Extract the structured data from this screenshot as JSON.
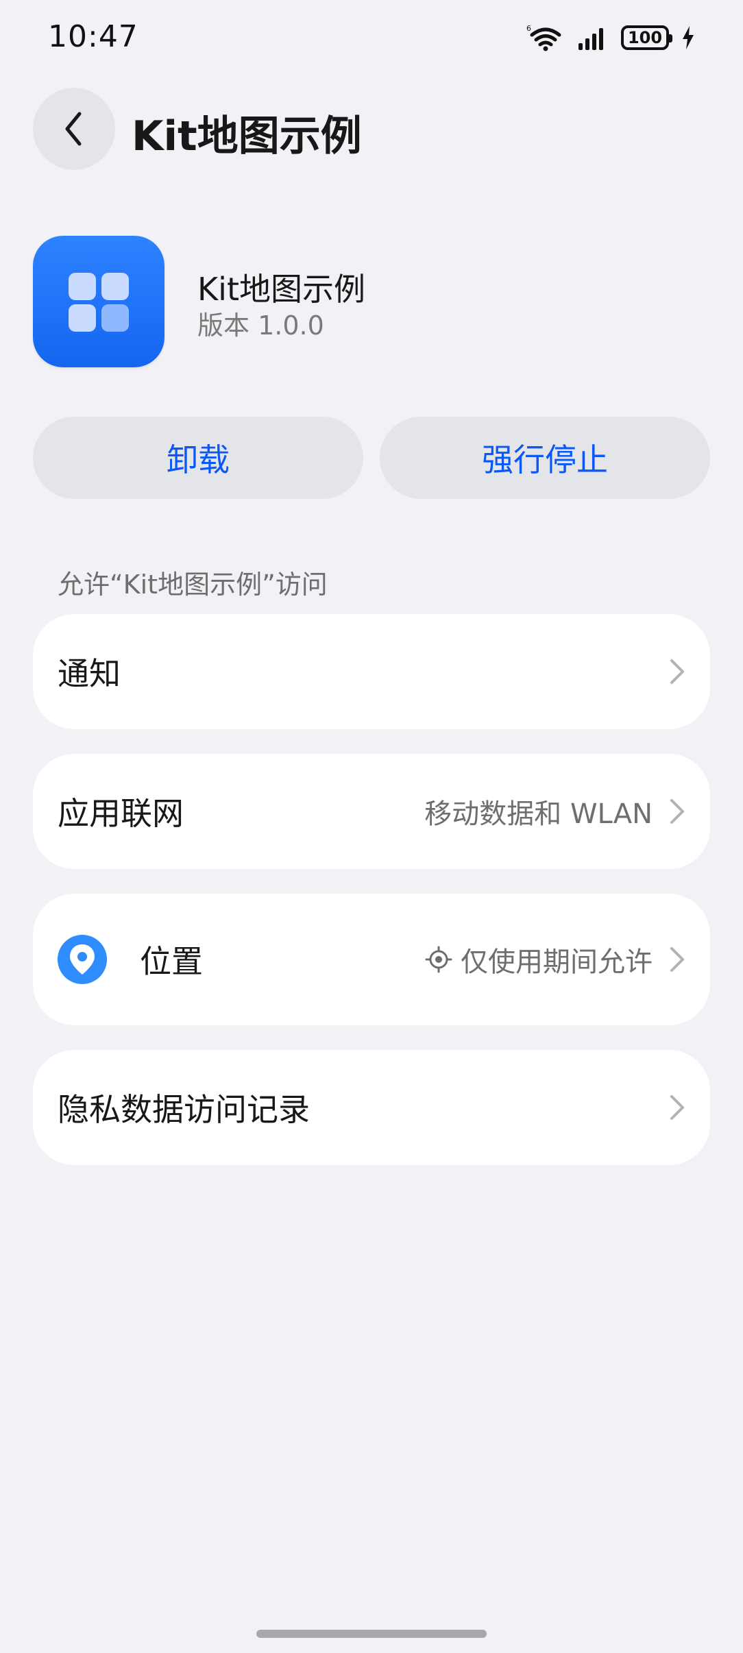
{
  "status_bar": {
    "time": "10:47",
    "battery": "100"
  },
  "header": {
    "title": "Kit地图示例"
  },
  "app": {
    "name": "Kit地图示例",
    "version": "版本 1.0.0",
    "icon_colors": [
      "#2e83ff",
      "#1565f0"
    ]
  },
  "actions": {
    "uninstall": "卸载",
    "force_stop": "强行停止"
  },
  "permissions": {
    "section_title": "允许“Kit地图示例”访问",
    "items": [
      {
        "label": "通知",
        "value": ""
      },
      {
        "label": "应用联网",
        "value": "移动数据和 WLAN"
      },
      {
        "label": "位置",
        "value": "仅使用期间允许"
      },
      {
        "label": "隐私数据访问记录",
        "value": ""
      }
    ]
  },
  "colors": {
    "accent": "#0a59f7",
    "background": "#f1f2f5",
    "location_badge": "#2f8cff"
  }
}
